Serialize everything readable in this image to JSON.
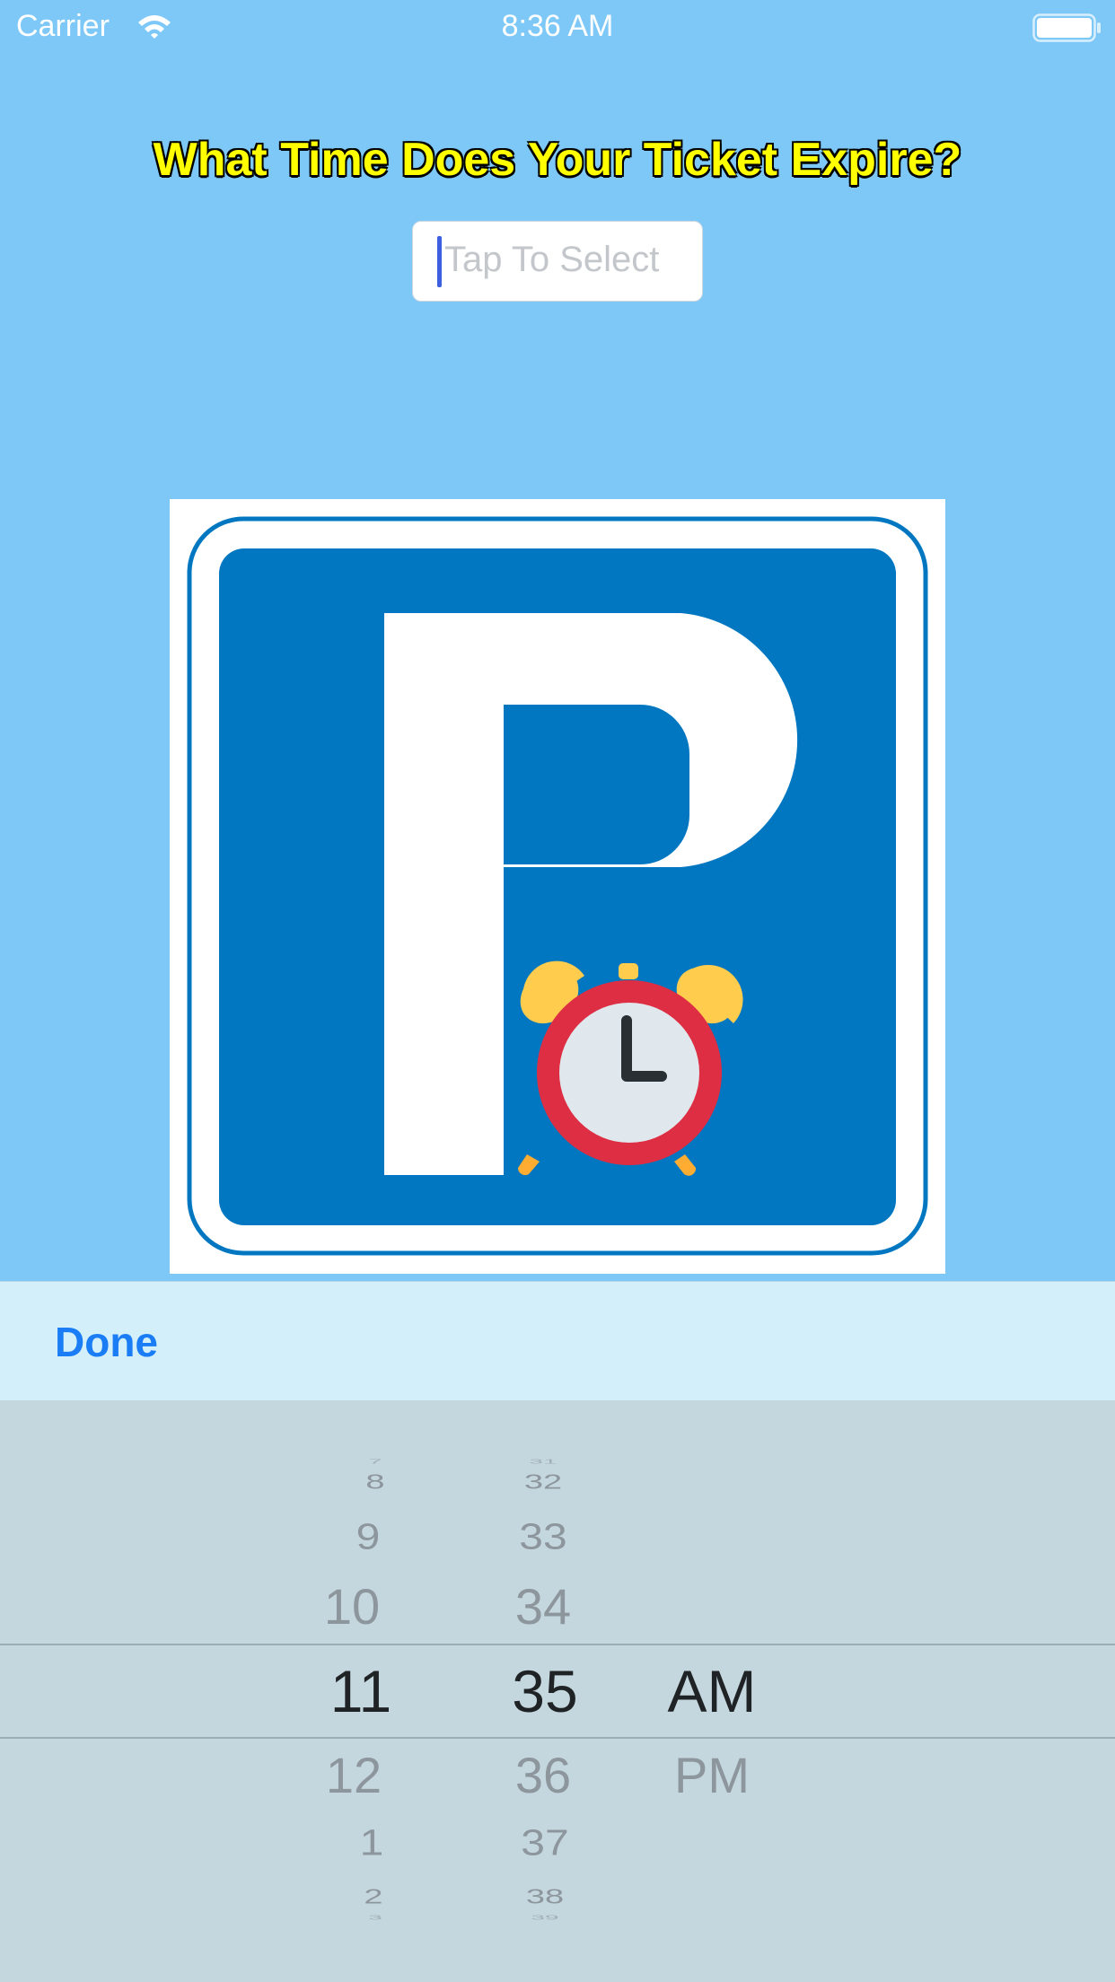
{
  "status_bar": {
    "carrier": "Carrier",
    "time": "8:36 AM",
    "wifi_icon": "wifi-icon",
    "battery_icon": "battery-full-icon"
  },
  "header": {
    "title": "What Time Does Your Ticket Expire?"
  },
  "time_field": {
    "placeholder": "Tap To Select",
    "value": ""
  },
  "image": {
    "description_icon": "parking-sign-with-alarm-clock",
    "colors": {
      "sign_blue": "#0077c0",
      "clock_red": "#dd2e44",
      "bells": "#ffcc4d"
    }
  },
  "toolbar": {
    "done_label": "Done"
  },
  "picker": {
    "hours": {
      "above": [
        "7",
        "8",
        "9",
        "10"
      ],
      "selected": "11",
      "below": [
        "12",
        "1",
        "2",
        "3"
      ]
    },
    "minutes": {
      "above": [
        "31",
        "32",
        "33",
        "34"
      ],
      "selected": "35",
      "below": [
        "36",
        "37",
        "38",
        "39"
      ]
    },
    "period": {
      "above": [],
      "selected": "AM",
      "below": [
        "PM"
      ]
    }
  }
}
